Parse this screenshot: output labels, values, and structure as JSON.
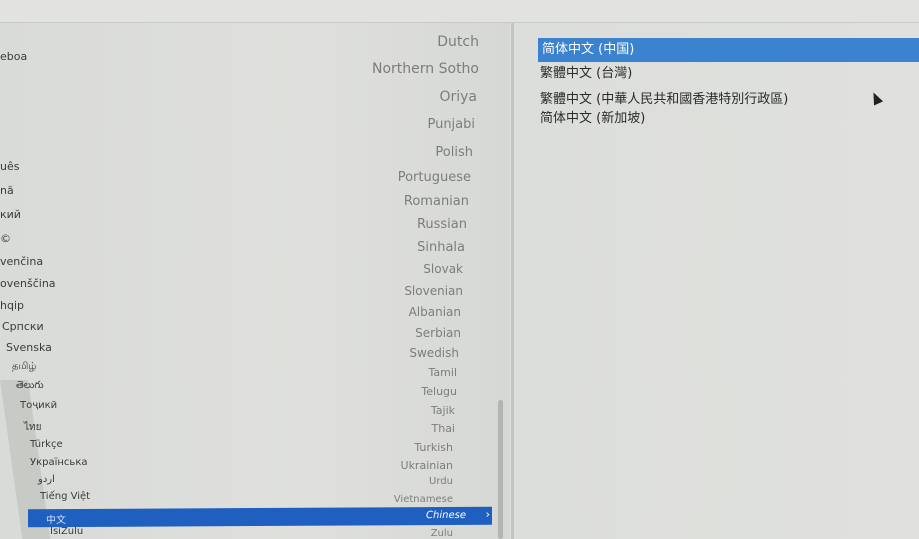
{
  "language_list": {
    "native_names": [
      "eboa",
      "uês",
      "nă",
      "кий",
      "©",
      "venčina",
      "ovenščina",
      "hqip",
      "Српски",
      "Svenska",
      "தமிழ்",
      "తెలుగు",
      "Тоҷикӣ",
      "ไทย",
      "Türkçe",
      "Українська",
      "اردو",
      "Tiếng Việt",
      "中文",
      "IsiZulu"
    ],
    "english_names": [
      "Dutch",
      "Northern Sotho",
      "Oriya",
      "Punjabi",
      "Polish",
      "Portuguese",
      "Romanian",
      "Russian",
      "Sinhala",
      "Slovak",
      "Slovenian",
      "Albanian",
      "Serbian",
      "Swedish",
      "Tamil",
      "Telugu",
      "Tajik",
      "Thai",
      "Turkish",
      "Ukrainian",
      "Urdu",
      "Vietnamese",
      "Chinese",
      "Zulu"
    ],
    "selected": {
      "native": "中文",
      "english": "Chinese"
    },
    "selected_color": "#1f5fbf"
  },
  "locale_list": {
    "items": [
      "简体中文 (中国)",
      "繁體中文 (台灣)",
      "繁體中文 (中華人民共和國香港特別行政區)",
      "简体中文 (新加坡)"
    ],
    "selected_index": 0,
    "selected_color": "#3b82cf"
  },
  "icons": {
    "chevron": "chevron-right-icon",
    "cursor": "mouse-pointer-icon"
  }
}
